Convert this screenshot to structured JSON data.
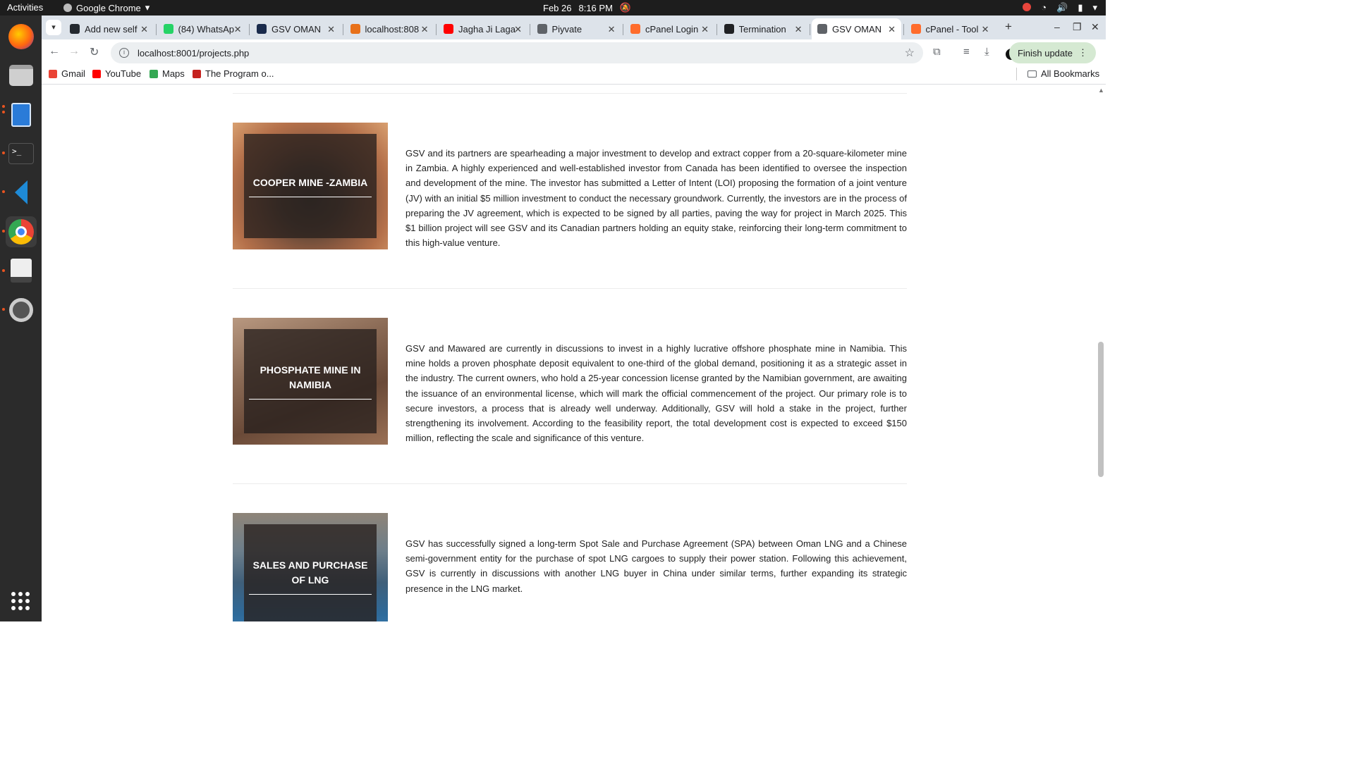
{
  "system_bar": {
    "activities": "Activities",
    "app_name": "Google Chrome",
    "date": "Feb 26",
    "time": "8:16 PM"
  },
  "dock": {
    "apps": [
      "firefox-icon",
      "files-icon",
      "writer-icon",
      "terminal-icon",
      "vscode-icon",
      "chrome-icon",
      "reader-icon",
      "settings-icon"
    ]
  },
  "browser": {
    "tabs": [
      {
        "title": "Add new self",
        "color": "#24292f"
      },
      {
        "title": "(84) WhatsAp",
        "color": "#25d366"
      },
      {
        "title": "GSV OMAN",
        "color": "#1a2b4c"
      },
      {
        "title": "localhost:808",
        "color": "#e8711a"
      },
      {
        "title": "Jagha Ji Laga",
        "color": "#ff0000"
      },
      {
        "title": "Piyvate",
        "color": "#5f6368"
      },
      {
        "title": "cPanel Login",
        "color": "#ff6c2c"
      },
      {
        "title": "Termination",
        "color": "#202124"
      },
      {
        "title": "GSV OMAN",
        "color": "#5f6368"
      },
      {
        "title": "cPanel - Tool",
        "color": "#ff6c2c"
      }
    ],
    "active_tab": 8,
    "url": "localhost:8001/projects.php",
    "finish_update": "Finish update",
    "bookmarks": [
      {
        "label": "Gmail",
        "color": "#ea4335"
      },
      {
        "label": "YouTube",
        "color": "#ff0000"
      },
      {
        "label": "Maps",
        "color": "#34a853"
      },
      {
        "label": "The Program o...",
        "color": "#c5221f"
      }
    ],
    "all_bookmarks": "All Bookmarks"
  },
  "projects": [
    {
      "title": "COOPER MINE -ZAMBIA",
      "description": "GSV and its partners are spearheading a major investment to develop and extract copper from a 20-square-kilometer mine in Zambia. A highly experienced and well-established investor from Canada has been identified to oversee the inspection and development of the mine. The investor has submitted a Letter of Intent (LOI) proposing the formation of a joint venture (JV) with an initial $5 million investment to conduct the necessary groundwork. Currently, the investors are in the process of preparing the JV agreement, which is expected to be signed by all parties, paving the way for project in March 2025. This $1 billion project will see GSV and its Canadian partners holding an equity stake, reinforcing their long-term commitment to this high-value venture."
    },
    {
      "title": "PHOSPHATE MINE IN NAMIBIA",
      "description": "GSV and Mawared are currently in discussions to invest in a highly lucrative offshore phosphate mine in Namibia. This mine holds a proven phosphate deposit equivalent to one-third of the global demand, positioning it as a strategic asset in the industry. The current owners, who hold a 25-year concession license granted by the Namibian government, are awaiting the issuance of an environmental license, which will mark the official commencement of the project. Our primary role is to secure investors, a process that is already well underway. Additionally, GSV will hold a stake in the project, further strengthening its involvement. According to the feasibility report, the total development cost is expected to exceed $150 million, reflecting the scale and significance of this venture."
    },
    {
      "title": "SALES AND PURCHASE OF LNG",
      "description": "GSV has successfully signed a long-term Spot Sale and Purchase Agreement (SPA) between Oman LNG and a Chinese semi-government entity for the purchase of spot LNG cargoes to supply their power station. Following this achievement, GSV is currently in discussions with another LNG buyer in China under similar terms, further expanding its strategic presence in the LNG market."
    }
  ]
}
